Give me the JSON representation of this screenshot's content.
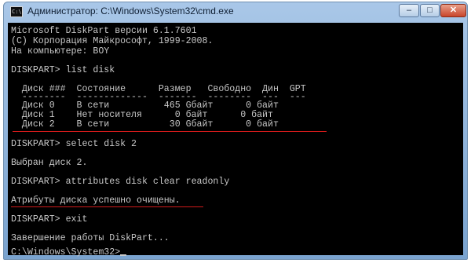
{
  "window": {
    "title": "Администратор: C:\\Windows\\System32\\cmd.exe",
    "app_icon_text": "C:\\.",
    "controls": {
      "minimize": "–",
      "maximize": "□",
      "close": "✕"
    }
  },
  "console": {
    "lines": [
      "Microsoft DiskPart версии 6.1.7601",
      "(C) Корпорация Майкрософт, 1999-2008.",
      "На компьютере: BOY",
      "DISKPART> list disk",
      "  Диск ###  Состояние      Размер   Свободно  Дин  GPT",
      "  --------  -------------  -------  --------  ---  ---",
      "  Диск 0    В сети          465 Gбайт      0 байт",
      "  Диск 1    Нет носителя      0 байт      0 байт",
      "  Диск 2    В сети           30 Gбайт      0 байт",
      "DISKPART> select disk 2",
      "Выбран диск 2.",
      "DISKPART> attributes disk clear readonly",
      "Атрибуты диска успешно очищены.",
      "DISKPART> exit",
      "Завершение работы DiskPart...",
      "C:\\Windows\\System32>"
    ]
  }
}
